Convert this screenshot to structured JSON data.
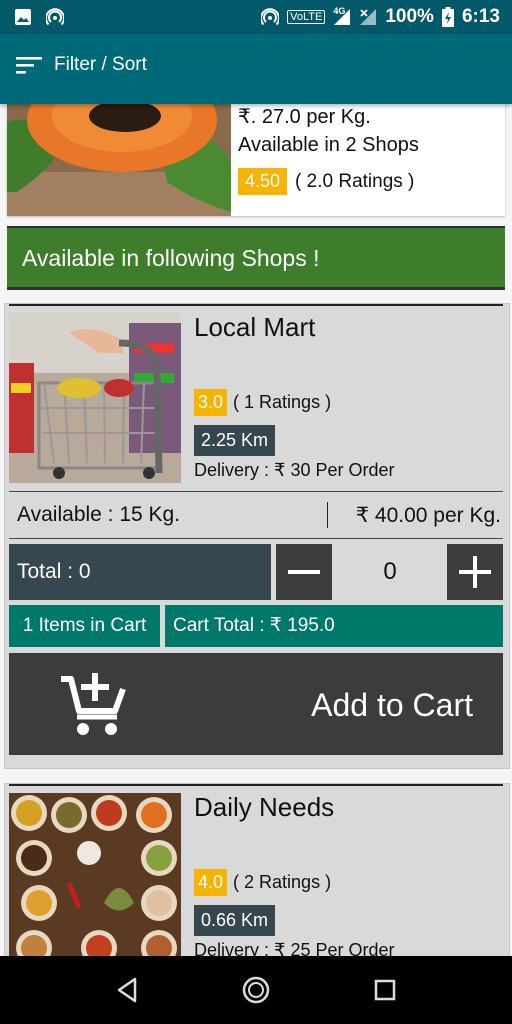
{
  "status_bar": {
    "network_label": "VoLTE",
    "network_type": "4G",
    "battery": "100%",
    "time": "6:13"
  },
  "app_bar": {
    "filter_label": "Filter / Sort"
  },
  "product": {
    "price": "₹. 27.0 per Kg.",
    "shops": "Available in 2 Shops",
    "rating": "4.50",
    "ratings_count": "( 2.0 Ratings )"
  },
  "banner": {
    "text": "Available in following Shops !"
  },
  "shops": [
    {
      "name": "Local Mart",
      "rating": "3.0",
      "ratings_count": "( 1 Ratings )",
      "distance": "2.25 Km",
      "delivery": "Delivery : ₹ 30 Per Order",
      "available": "Available : 15 Kg.",
      "price": "₹ 40.00 per Kg.",
      "total": "Total : 0",
      "quantity": "0",
      "items_in_cart": "1 Items in Cart",
      "cart_total": "Cart Total : ₹ 195.0",
      "add_to_cart": "Add to Cart"
    },
    {
      "name": "Daily Needs",
      "rating": "4.0",
      "ratings_count": "( 2 Ratings )",
      "distance": "0.66 Km",
      "delivery": "Delivery : ₹ 25 Per Order"
    }
  ],
  "colors": {
    "status_bar": "#03596a",
    "app_bar": "#006977",
    "banner": "#3e7d2a",
    "rating_badge": "#f5b400",
    "teal": "#00796b",
    "dark_button": "#3c3c3c",
    "distance_badge": "#37474f"
  }
}
